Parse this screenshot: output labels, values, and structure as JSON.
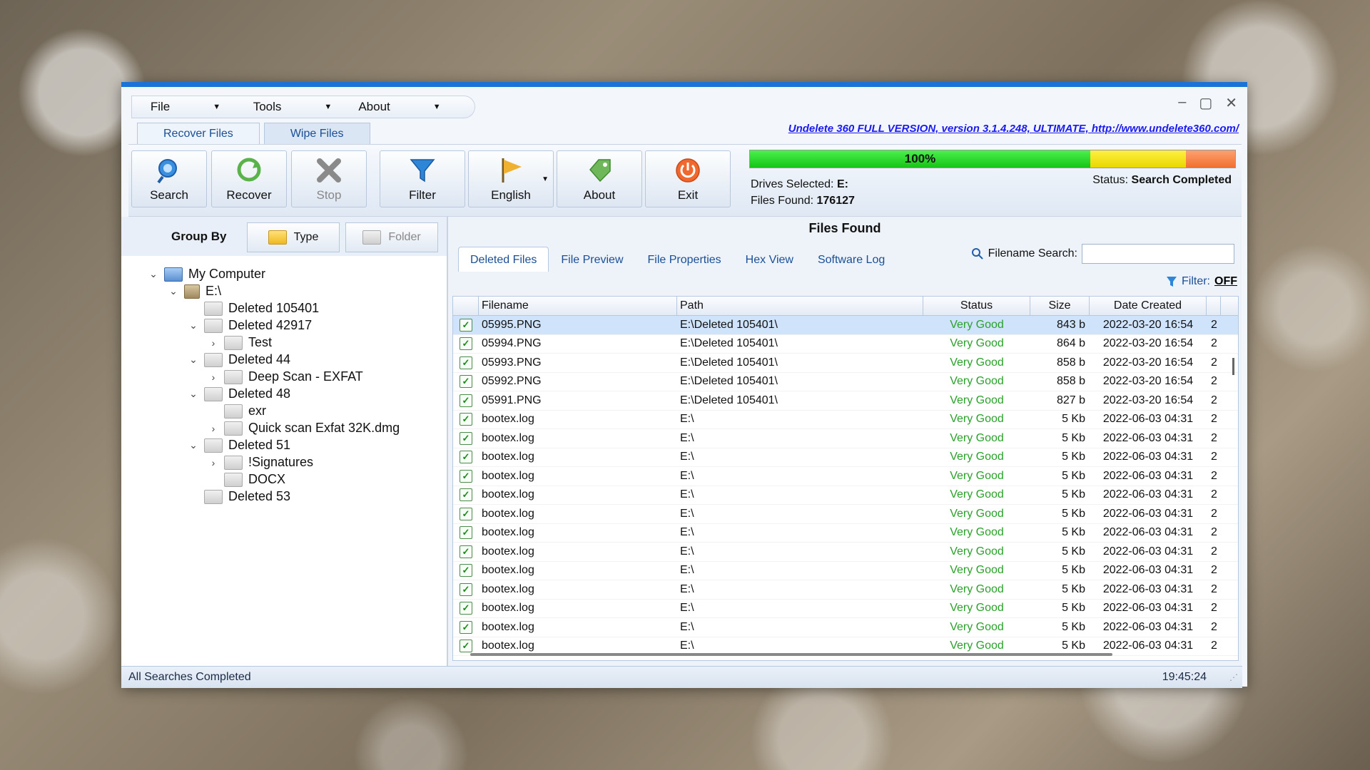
{
  "menu": {
    "items": [
      {
        "label": "File"
      },
      {
        "label": "Tools"
      },
      {
        "label": "About"
      }
    ]
  },
  "top_tabs": [
    {
      "label": "Recover Files",
      "active": true
    },
    {
      "label": "Wipe Files",
      "active": false
    }
  ],
  "headline": "Undelete 360 FULL VERSION, version 3.1.4.248, ULTIMATE, http://www.undelete360.com/",
  "toolbar": {
    "search": "Search",
    "recover": "Recover",
    "stop": "Stop",
    "filter": "Filter",
    "language": "English",
    "about": "About",
    "exit": "Exit"
  },
  "progress": {
    "value_percent": 100,
    "label": "100%"
  },
  "info": {
    "drives_label": "Drives Selected:",
    "drives_value": "E:",
    "files_label": "Files Found:",
    "files_value": "176127",
    "status_label": "Status:",
    "status_value": "Search Completed"
  },
  "group_by": {
    "label": "Group By",
    "type": "Type",
    "folder": "Folder"
  },
  "tree": {
    "my_computer": "My Computer",
    "drive": "E:\\",
    "d105401": "Deleted 105401",
    "d42917": "Deleted 42917",
    "test": "Test",
    "d44": "Deleted 44",
    "deepscan": "Deep Scan - EXFAT",
    "d48": "Deleted 48",
    "exr": "exr",
    "quickscan": "Quick scan Exfat 32K.dmg",
    "d51": "Deleted 51",
    "signatures": "!Signatures",
    "docx": "DOCX",
    "d53": "Deleted 53"
  },
  "files_panel": {
    "title": "Files Found",
    "tabs": [
      "Deleted Files",
      "File Preview",
      "File Properties",
      "Hex View",
      "Software Log"
    ],
    "search_label": "Filename Search:",
    "filter_label": "Filter:",
    "filter_value": "OFF"
  },
  "table": {
    "headers": {
      "filename": "Filename",
      "path": "Path",
      "status": "Status",
      "size": "Size",
      "date": "Date Created"
    },
    "rows": [
      {
        "f": "05995.PNG",
        "p": "E:\\Deleted 105401\\",
        "s": "Very Good",
        "z": "843 b",
        "d": "2022-03-20 16:54",
        "x": "2"
      },
      {
        "f": "05994.PNG",
        "p": "E:\\Deleted 105401\\",
        "s": "Very Good",
        "z": "864 b",
        "d": "2022-03-20 16:54",
        "x": "2"
      },
      {
        "f": "05993.PNG",
        "p": "E:\\Deleted 105401\\",
        "s": "Very Good",
        "z": "858 b",
        "d": "2022-03-20 16:54",
        "x": "2"
      },
      {
        "f": "05992.PNG",
        "p": "E:\\Deleted 105401\\",
        "s": "Very Good",
        "z": "858 b",
        "d": "2022-03-20 16:54",
        "x": "2"
      },
      {
        "f": "05991.PNG",
        "p": "E:\\Deleted 105401\\",
        "s": "Very Good",
        "z": "827 b",
        "d": "2022-03-20 16:54",
        "x": "2"
      },
      {
        "f": "bootex.log",
        "p": "E:\\",
        "s": "Very Good",
        "z": "5 Kb",
        "d": "2022-06-03 04:31",
        "x": "2"
      },
      {
        "f": "bootex.log",
        "p": "E:\\",
        "s": "Very Good",
        "z": "5 Kb",
        "d": "2022-06-03 04:31",
        "x": "2"
      },
      {
        "f": "bootex.log",
        "p": "E:\\",
        "s": "Very Good",
        "z": "5 Kb",
        "d": "2022-06-03 04:31",
        "x": "2"
      },
      {
        "f": "bootex.log",
        "p": "E:\\",
        "s": "Very Good",
        "z": "5 Kb",
        "d": "2022-06-03 04:31",
        "x": "2"
      },
      {
        "f": "bootex.log",
        "p": "E:\\",
        "s": "Very Good",
        "z": "5 Kb",
        "d": "2022-06-03 04:31",
        "x": "2"
      },
      {
        "f": "bootex.log",
        "p": "E:\\",
        "s": "Very Good",
        "z": "5 Kb",
        "d": "2022-06-03 04:31",
        "x": "2"
      },
      {
        "f": "bootex.log",
        "p": "E:\\",
        "s": "Very Good",
        "z": "5 Kb",
        "d": "2022-06-03 04:31",
        "x": "2"
      },
      {
        "f": "bootex.log",
        "p": "E:\\",
        "s": "Very Good",
        "z": "5 Kb",
        "d": "2022-06-03 04:31",
        "x": "2"
      },
      {
        "f": "bootex.log",
        "p": "E:\\",
        "s": "Very Good",
        "z": "5 Kb",
        "d": "2022-06-03 04:31",
        "x": "2"
      },
      {
        "f": "bootex.log",
        "p": "E:\\",
        "s": "Very Good",
        "z": "5 Kb",
        "d": "2022-06-03 04:31",
        "x": "2"
      },
      {
        "f": "bootex.log",
        "p": "E:\\",
        "s": "Very Good",
        "z": "5 Kb",
        "d": "2022-06-03 04:31",
        "x": "2"
      },
      {
        "f": "bootex.log",
        "p": "E:\\",
        "s": "Very Good",
        "z": "5 Kb",
        "d": "2022-06-03 04:31",
        "x": "2"
      },
      {
        "f": "bootex.log",
        "p": "E:\\",
        "s": "Very Good",
        "z": "5 Kb",
        "d": "2022-06-03 04:31",
        "x": "2"
      }
    ]
  },
  "statusbar": {
    "left": "All Searches Completed",
    "time": "19:45:24"
  },
  "colors": {
    "accent": "#1a73d6",
    "status_good": "#2aa12a",
    "link": "#1a1aee"
  }
}
